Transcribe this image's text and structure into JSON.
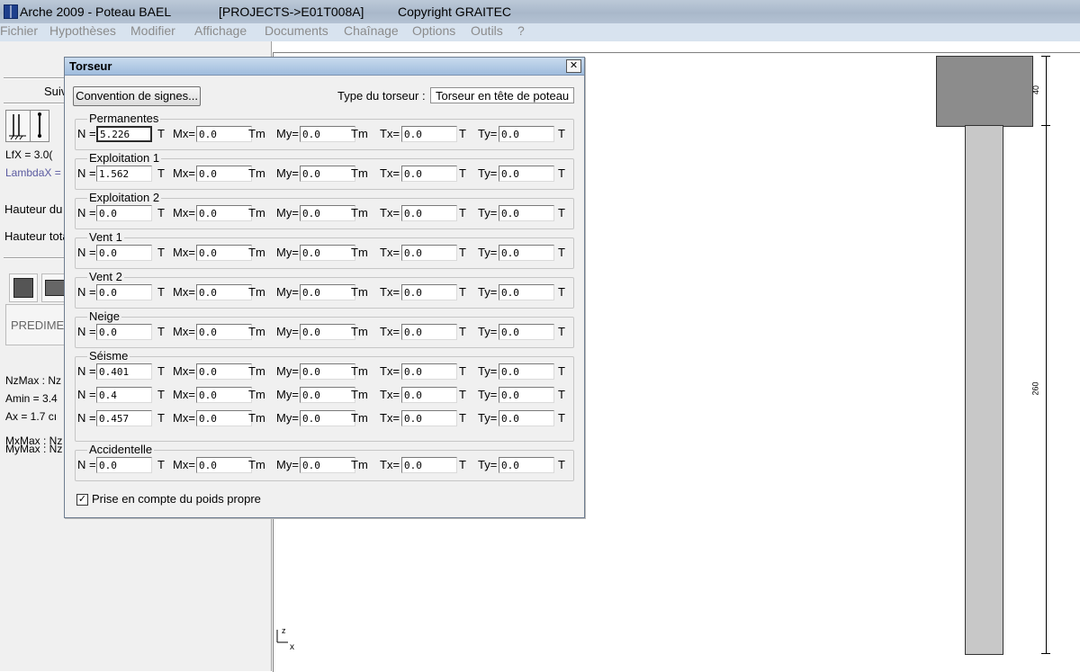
{
  "window": {
    "title_app": "Arche 2009 - Poteau BAEL",
    "title_project": "[PROJECTS->E01T008A]",
    "title_copyright": "Copyright GRAITEC"
  },
  "menu": [
    "Fichier",
    "Hypothèses",
    "Modifier",
    "Affichage",
    "Documents",
    "Chaînage",
    "Options",
    "Outils",
    "?"
  ],
  "left_panel": {
    "suiv": "Suiv",
    "lfx": "LfX   =  3.0(",
    "lambdax": "LambdaX =",
    "hauteur_du": "Hauteur du",
    "hauteur_tot": "Hauteur tota",
    "predime": "PREDIME",
    "nzmax": "NzMax : Nz",
    "amin": "Amin =  3.4",
    "ax": "Ax  =  1.7 cı",
    "mxmax": "MxMax : Nz",
    "mymax": "MyMax : Nz"
  },
  "dialog": {
    "title": "Torseur",
    "close_glyph": "✕",
    "convention_button": "Convention de signes...",
    "type_label": "Type du torseur :",
    "type_value": "Torseur en tête de poteau",
    "labels": {
      "n": "N =",
      "mx": "Mx=",
      "my": "My=",
      "tx": "Tx=",
      "ty": "Ty=",
      "t": "T",
      "tm": "Tm"
    },
    "groups": [
      {
        "title": "Permanentes",
        "rows": [
          {
            "N": "5.226",
            "Mx": "0.0",
            "My": "0.0",
            "Tx": "0.0",
            "Ty": "0.0"
          }
        ]
      },
      {
        "title": "Exploitation 1",
        "rows": [
          {
            "N": "1.562",
            "Mx": "0.0",
            "My": "0.0",
            "Tx": "0.0",
            "Ty": "0.0"
          }
        ]
      },
      {
        "title": "Exploitation 2",
        "rows": [
          {
            "N": "0.0",
            "Mx": "0.0",
            "My": "0.0",
            "Tx": "0.0",
            "Ty": "0.0"
          }
        ]
      },
      {
        "title": "Vent 1",
        "rows": [
          {
            "N": "0.0",
            "Mx": "0.0",
            "My": "0.0",
            "Tx": "0.0",
            "Ty": "0.0"
          }
        ]
      },
      {
        "title": "Vent 2",
        "rows": [
          {
            "N": "0.0",
            "Mx": "0.0",
            "My": "0.0",
            "Tx": "0.0",
            "Ty": "0.0"
          }
        ]
      },
      {
        "title": "Neige",
        "rows": [
          {
            "N": "0.0",
            "Mx": "0.0",
            "My": "0.0",
            "Tx": "0.0",
            "Ty": "0.0"
          }
        ]
      },
      {
        "title": "Séisme",
        "rows": [
          {
            "N": "0.401",
            "Mx": "0.0",
            "My": "0.0",
            "Tx": "0.0",
            "Ty": "0.0"
          },
          {
            "N": "0.4",
            "Mx": "0.0",
            "My": "0.0",
            "Tx": "0.0",
            "Ty": "0.0"
          },
          {
            "N": "0.457",
            "Mx": "0.0",
            "My": "0.0",
            "Tx": "0.0",
            "Ty": "0.0"
          }
        ]
      },
      {
        "title": "Accidentelle",
        "rows": [
          {
            "N": "0.0",
            "Mx": "0.0",
            "My": "0.0",
            "Tx": "0.0",
            "Ty": "0.0"
          }
        ]
      }
    ],
    "self_weight": {
      "checked": true,
      "check_glyph": "✓",
      "label": "Prise en compte du poids propre"
    }
  },
  "drawing": {
    "dim_head": "40",
    "dim_shaft": "260",
    "axis_z": "z",
    "axis_x": "x",
    "head_color": "#8c8c8c",
    "shaft_color": "#c8c8c8"
  }
}
